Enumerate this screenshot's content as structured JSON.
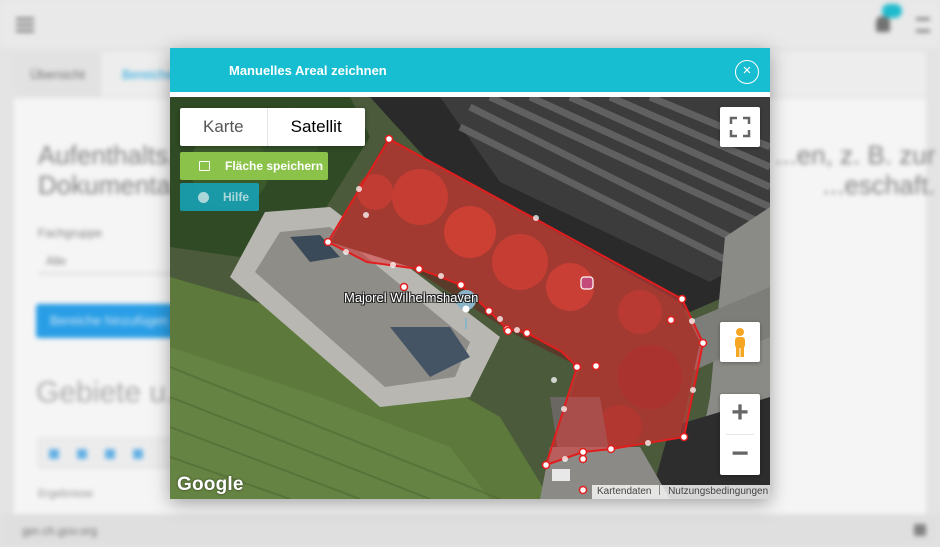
{
  "background": {
    "tabs": [
      "Übersicht",
      "Bereiche"
    ],
    "heading_left": "Aufenthalts...\nDokumenta...",
    "heading_right": "...en, z. B. zur\n...eschaft.",
    "field_label": "Fachgruppe",
    "field_value": "Alle",
    "primary_button": "Bereiche hinzufügen",
    "section_title": "Gebiete u...",
    "small_label": "Ergebnisse",
    "footer_text": "ger.ch.gov.org"
  },
  "modal": {
    "title": "Manuelles Areal zeichnen",
    "close_glyph": "×"
  },
  "map": {
    "map_types": [
      "Karte",
      "Satellit"
    ],
    "selected_map_type": "Satellit",
    "save_button": "Fläche speichern",
    "help_button": "Hilfe",
    "place_label": "Majorel Wilhelmshaven",
    "logo": "Google",
    "attribution": [
      "Kartendaten",
      "Nutzungsbedingungen"
    ],
    "zoom_in": "+",
    "zoom_out": "−",
    "polygon_fill": "#d93a3a",
    "polygon_stroke": "#e01e1e",
    "header_color": "#17bdd1",
    "save_color": "#8bc34a"
  }
}
